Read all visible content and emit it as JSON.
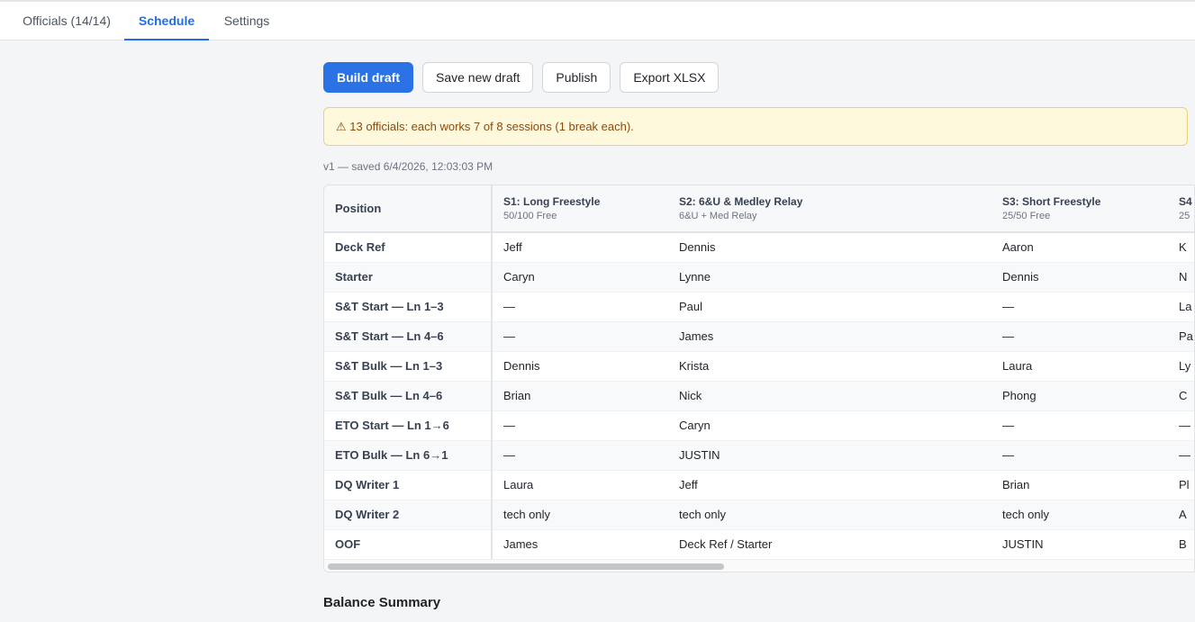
{
  "tabs": [
    {
      "label": "Officials (14/14)",
      "active": false
    },
    {
      "label": "Schedule",
      "active": true
    },
    {
      "label": "Settings",
      "active": false
    }
  ],
  "toolbar": {
    "build_label": "Build draft",
    "save_label": "Save new draft",
    "publish_label": "Publish",
    "export_label": "Export XLSX"
  },
  "alert": {
    "icon": "warning-icon",
    "text": "⚠ 13 officials: each works 7 of 8 sessions (1 break each)."
  },
  "version": "v1 — saved 6/4/2026, 12:03:03 PM",
  "table": {
    "position_header": "Position",
    "sessions": [
      {
        "title": "S1: Long Freestyle",
        "sub": "50/100 Free"
      },
      {
        "title": "S2: 6&U & Medley Relay",
        "sub": "6&U + Med Relay"
      },
      {
        "title": "S3: Short Freestyle",
        "sub": "25/50 Free"
      },
      {
        "title": "S4",
        "sub": "25"
      }
    ],
    "rows": [
      {
        "position": "Deck Ref",
        "cells": [
          "Jeff",
          "Dennis",
          "Aaron",
          "K"
        ]
      },
      {
        "position": "Starter",
        "cells": [
          "Caryn",
          "Lynne",
          "Dennis",
          "N"
        ]
      },
      {
        "position": "S&T Start — Ln 1–3",
        "cells": [
          "—",
          "Paul",
          "—",
          "La"
        ]
      },
      {
        "position": "S&T Start — Ln 4–6",
        "cells": [
          "—",
          "James",
          "—",
          "Pa"
        ]
      },
      {
        "position": "S&T Bulk — Ln 1–3",
        "cells": [
          "Dennis",
          "Krista",
          "Laura",
          "Ly"
        ]
      },
      {
        "position": "S&T Bulk — Ln 4–6",
        "cells": [
          "Brian",
          "Nick",
          "Phong",
          "C"
        ]
      },
      {
        "position": "ETO Start — Ln 1→6",
        "cells": [
          "—",
          "Caryn",
          "—",
          "—"
        ]
      },
      {
        "position": "ETO Bulk — Ln 6→1",
        "cells": [
          "—",
          "JUSTIN",
          "—",
          "—"
        ]
      },
      {
        "position": "DQ Writer 1",
        "cells": [
          "Laura",
          "Jeff",
          "Brian",
          "Pl"
        ]
      },
      {
        "position": "DQ Writer 2",
        "cells": [
          "tech only",
          "tech only",
          "tech only",
          "A"
        ]
      },
      {
        "position": "OOF",
        "cells": [
          "James",
          "Deck Ref / Starter",
          "JUSTIN",
          "B"
        ]
      }
    ]
  },
  "balance_summary_title": "Balance Summary"
}
